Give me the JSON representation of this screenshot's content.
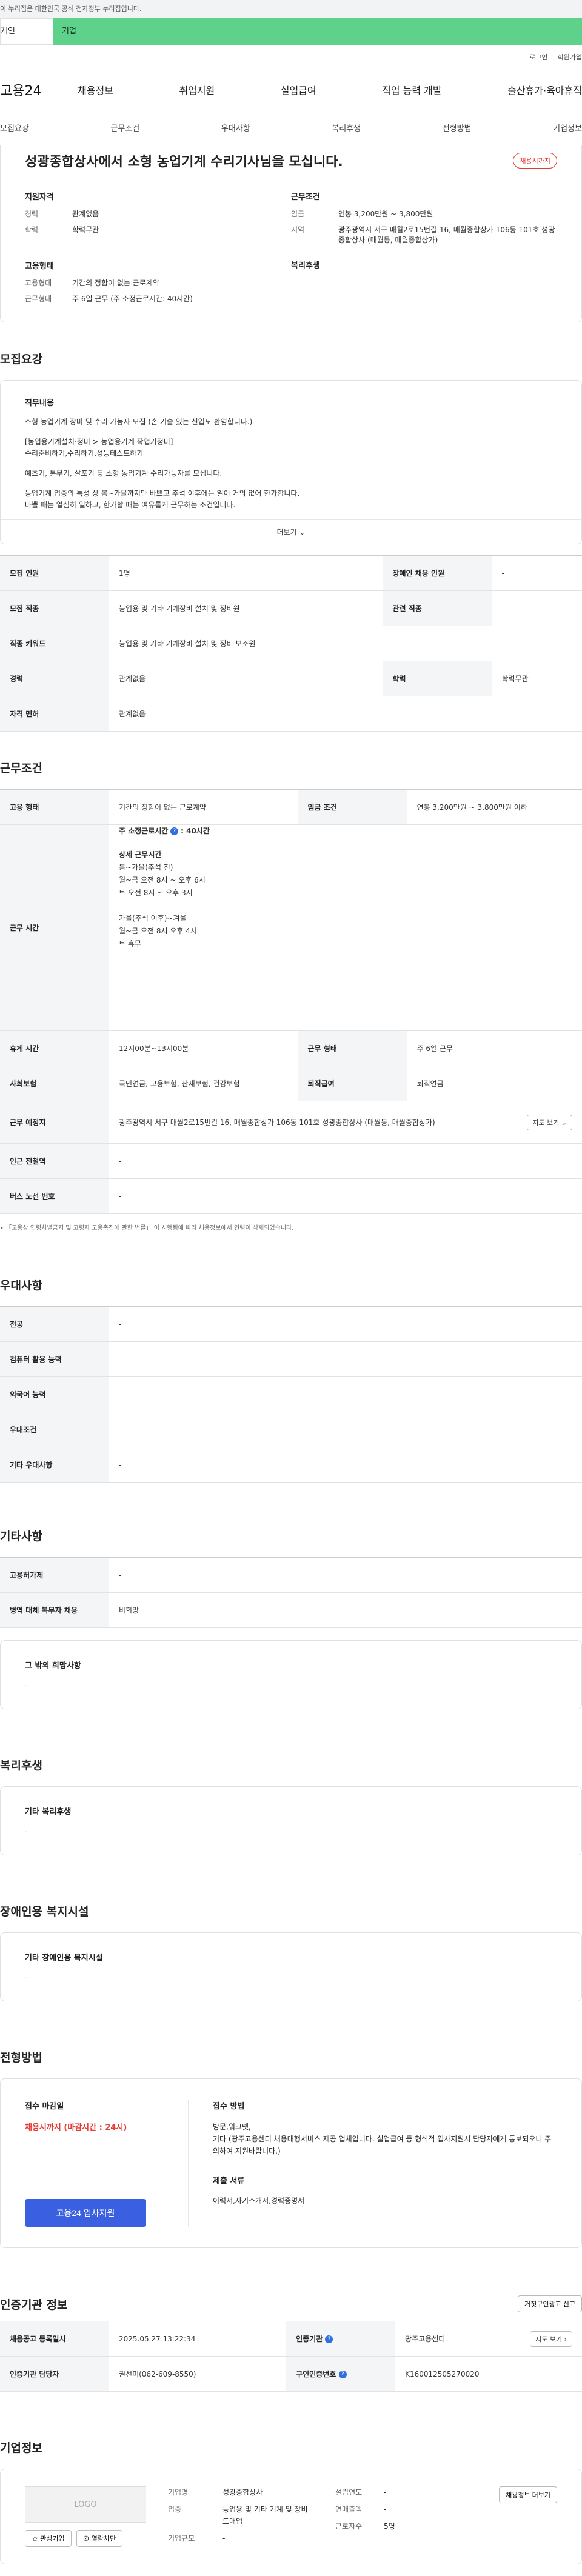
{
  "banner": "이 누리집은 대한민국 공식 전자정부 누리집입니다.",
  "tabs": {
    "person": "개인",
    "biz": "기업"
  },
  "util": {
    "login": "로그인",
    "join": "회원가입"
  },
  "gnb": {
    "logo": "고용24",
    "menu": [
      "채용정보",
      "취업지원",
      "실업급여",
      "직업 능력 개발",
      "출산휴가·육아휴직"
    ]
  },
  "snb": [
    "모집요강",
    "근무조건",
    "우대사항",
    "복리후생",
    "전형방법",
    "기업정보"
  ],
  "head": {
    "title": "성광종합상사에서 소형 농업기계 수리기사님을 모십니다.",
    "badge": "채용시까지",
    "qual_title": "지원자격",
    "career_k": "경력",
    "career_v": "관계없음",
    "edu_k": "학력",
    "edu_v": "학력무관",
    "cond_title": "근무조건",
    "pay_k": "임금",
    "pay_v": "연봉 3,200만원 ~ 3,800만원",
    "area_k": "지역",
    "area_v": "광주광역시 서구 매월2로15번길 16, 매월종합상가 106동 101호 성광종합상사 (매월동, 매월종합상가)",
    "emp_title": "고용형태",
    "emp_k": "고용형태",
    "emp_v": "기간의 정함이 없는 근로계약",
    "worktype_k": "근무형태",
    "worktype_v": "주 6일 근무 (주 소정근로시간: 40시간)",
    "wel_title": "복리후생"
  },
  "recruit": {
    "section": "모집요강",
    "job_label": "직무내용",
    "p1": "소형 농업기계 장비 및 수리 가능자 모집 (손 기술 있는 신입도 환영합니다.)",
    "p2a": "[농업용기계설치·정비 > 농업용기계 작업기정비]",
    "p2b": "수리준비하기,수리하기,성능테스트하기",
    "p3": "예초기, 분무기, 살포기 등 소형 농업기계 수리가능자를 모십니다.",
    "p4a": "농업기계 업종의 특성 상 봄~가을까지만 바쁘고 추석 이후에는 일이 거의 없어 한가합니다.",
    "p4b": "바쁠 때는 열심히 일하고, 한가할 때는 여유롭게 근무하는 조건입니다.",
    "more": "더보기 ⌄",
    "rows": {
      "count_k": "모집 인원",
      "count_v": "1명",
      "disabled_k": "장애인 채용 인원",
      "disabled_v": "-",
      "job_k": "모집 직종",
      "job_v": "농업용 및 기타 기계장비 설치 및 정비원",
      "rel_k": "관련 직종",
      "rel_v": "-",
      "kw_k": "직종 키워드",
      "kw_v": "농업용 및 기타 기계장비 설치 및 정비 보조원",
      "career_k": "경력",
      "career_v": "관계없음",
      "edu_k": "학력",
      "edu_v": "학력무관",
      "lic_k": "자격 면허",
      "lic_v": "관계없음"
    }
  },
  "work": {
    "section": "근무조건",
    "type_k": "고용 형태",
    "type_v": "기간의 정함이 없는 근로계약",
    "pay_k": "임금 조건",
    "pay_v": "연봉 3,200만원 ~ 3,800만원 이하",
    "hours_k": "근무 시간",
    "hours_head": "주 소정근로시간",
    "hours_num": ": 40시간",
    "detail_title": "상세 근무시간",
    "d1": "봄~가을(추석 전)",
    "d2": "월~금 오전 8시 ~ 오후 6시",
    "d3": "토 오전 8시 ~ 오후 3시",
    "d4": "가을(추석 이후)~겨울",
    "d5": "월~금 오전 8시 오후 4시",
    "d6": "토   휴무",
    "break_k": "휴게 시간",
    "break_v": "12시00분~13시00분",
    "form_k": "근무 형태",
    "form_v": "주 6일 근무",
    "ins_k": "사회보험",
    "ins_v": "국민연금, 고용보험, 산재보험, 건강보험",
    "ret_k": "퇴직급여",
    "ret_v": "퇴직연금",
    "place_k": "근무 예정지",
    "place_v": "광주광역시 서구 매월2로15번길 16, 매월종합상가 106동 101호 성광종합상사 (매월동, 매월종합상가)",
    "map_btn": "지도 보기 ⌄",
    "ind_k": "인근 전철역",
    "ind_v": "-",
    "bus_k": "버스 노선 번호",
    "bus_v": "-",
    "note": "「고용상 연령차별금지 및 고령자 고용촉진에 관한 법률」 이 시행됨에 따라 채용정보에서 연령이 삭제되었습니다."
  },
  "pref": {
    "section": "우대사항",
    "rows": [
      {
        "k": "전공",
        "v": "-"
      },
      {
        "k": "컴퓨터 활용 능력",
        "v": "-"
      },
      {
        "k": "외국어 능력",
        "v": "-"
      },
      {
        "k": "우대조건",
        "v": "-"
      },
      {
        "k": "기타 우대사항",
        "v": "-"
      }
    ]
  },
  "etc": {
    "section": "기타사항",
    "rows": [
      {
        "k": "고용허가제",
        "v": "-"
      },
      {
        "k": "병역 대체 복무자 채용",
        "v": "비희망"
      }
    ],
    "wish_label": "그 밖의 희망사항",
    "wish_v": "-"
  },
  "welfare": {
    "section": "복리후생",
    "label": "기타 복리후생",
    "v": "-"
  },
  "disab": {
    "section": "장애인용 복지시설",
    "label": "기타 장애인용 복지시설",
    "v": "-"
  },
  "selection": {
    "section": "전형방법",
    "deadline_label": "접수 마감일",
    "deadline_v": "채용시까지 (마감시간 : 24시)",
    "apply_btn": "고용24 입사지원",
    "method_label": "접수 방법",
    "method_v1": "방문,워크넷,",
    "method_v2": "기타 (광주고용센터 채용대행서비스 제공 업체입니다. 실업급여 등 형식적 입사지원시 담당자에게 통보되오니 주의하여 지원바랍니다.)",
    "docs_label": "제출 서류",
    "docs_v": "이력서,자기소개서,경력증명서"
  },
  "agency": {
    "section": "인증기관 정보",
    "report_btn": "거짓구인광고 신고",
    "reg_k": "채용공고 등록일시",
    "reg_v": "2025.05.27 13:22:34",
    "org_k": "인증기관",
    "org_v": "광주고용센터",
    "map_btn": "지도 보기 ›",
    "mgr_k": "인증기관 담당자",
    "mgr_v": "권선미(062-609-8550)",
    "no_k": "구인인증번호",
    "no_v": "K160012505270020"
  },
  "company": {
    "section": "기업정보",
    "logo": "LOGO",
    "fav_btn": "관심기업",
    "block_btn": "열람차단",
    "name_k": "기업명",
    "name_v": "성광종합상사",
    "ind_k": "업종",
    "ind_v": "농업용 및 기타 기계 및 장비 도매업",
    "scale_k": "기업규모",
    "scale_v": "-",
    "est_k": "설립연도",
    "est_v": "-",
    "sales_k": "연매출액",
    "sales_v": "-",
    "emp_k": "근로자수",
    "emp_v": "5명",
    "more_btn": "채용정보 더보기"
  }
}
